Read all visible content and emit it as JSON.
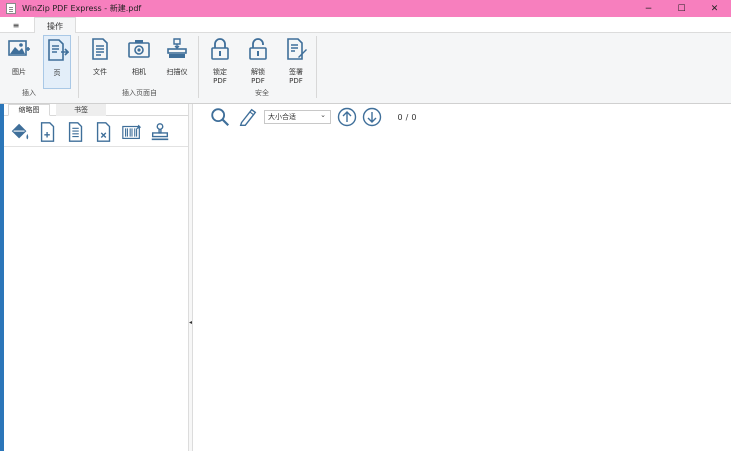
{
  "window": {
    "app_name": "WinZip PDF Express",
    "doc_name": "新建.pdf",
    "controls": {
      "minimize": "−",
      "maximize": "☐",
      "close": "✕"
    }
  },
  "menu": {
    "file_label": "≡",
    "tabs": [
      {
        "label": "操作"
      }
    ]
  },
  "ribbon": {
    "groups": [
      {
        "label": "插入",
        "items": [
          {
            "label": "图片",
            "icon": "image-insert-icon"
          },
          {
            "label": "页",
            "icon": "page-insert-icon"
          }
        ]
      },
      {
        "label": "插入页面自",
        "items": [
          {
            "label": "文件",
            "icon": "file-icon"
          },
          {
            "label": "相机",
            "icon": "camera-icon"
          },
          {
            "label": "扫描仪",
            "icon": "scanner-icon"
          }
        ]
      },
      {
        "label": "安全",
        "items": [
          {
            "label": "锁定\nPDF",
            "icon": "lock-icon"
          },
          {
            "label": "解锁\nPDF",
            "icon": "unlock-icon"
          },
          {
            "label": "签署\nPDF",
            "icon": "sign-icon"
          }
        ]
      }
    ]
  },
  "left_panel": {
    "tabs": [
      {
        "label": "缩略图",
        "selected": true
      },
      {
        "label": "书签",
        "selected": false
      }
    ],
    "tools": [
      "fill-bucket-icon",
      "add-page-icon",
      "extract-page-icon",
      "delete-page-icon",
      "barcode-icon",
      "stamp-icon"
    ]
  },
  "viewer": {
    "zoom": {
      "value": "大小合适"
    },
    "page": {
      "current": "0",
      "separator": "/",
      "total": "0"
    }
  },
  "colors": {
    "title_bar": "#f77fbe",
    "accent": "#2b76b9",
    "icon": "#3f6f9a"
  }
}
